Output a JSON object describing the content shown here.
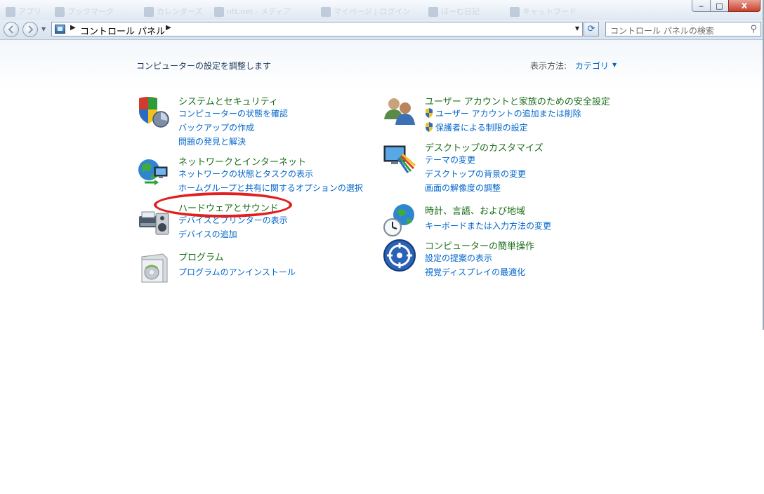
{
  "titlebar": {
    "tabs": [
      "アプリ",
      "ブックマーク",
      "カレンダーズ",
      "ntt.net - メディア",
      "マイページ | ログイン",
      "ほーむ日記 ",
      "キャットフード"
    ]
  },
  "window_controls": {
    "minimize": "‒",
    "maximize": "□",
    "close": "X"
  },
  "nav": {
    "breadcrumb_root": "コントロール パネル",
    "search_placeholder": "コントロール パネルの検索"
  },
  "header": {
    "title": "コンピューターの設定を調整します",
    "view_by_label": "表示方法:",
    "view_by_value": "カテゴリ"
  },
  "categories_left": [
    {
      "icon": "shield-icon",
      "title": "システムとセキュリティ",
      "links": [
        "コンピューターの状態を確認",
        "バックアップの作成",
        "問題の発見と解決"
      ]
    },
    {
      "icon": "network-globe-icon",
      "title": "ネットワークとインターネット",
      "links": [
        "ネットワークの状態とタスクの表示",
        "ホームグループと共有に関するオプションの選択"
      ]
    },
    {
      "icon": "printer-speaker-icon",
      "title": "ハードウェアとサウンド",
      "links": [
        "デバイスとプリンターの表示",
        "デバイスの追加"
      ]
    },
    {
      "icon": "programs-box-icon",
      "title": "プログラム",
      "links": [
        "プログラムのアンインストール"
      ]
    }
  ],
  "categories_right": [
    {
      "icon": "users-icon",
      "title": "ユーザー アカウントと家族のための安全設定",
      "links": [
        "ユーザー アカウントの追加または削除",
        "保護者による制限の設定"
      ]
    },
    {
      "icon": "monitor-palette-icon",
      "title": "デスクトップのカスタマイズ",
      "links": [
        "テーマの変更",
        "デスクトップの背景の変更",
        "画面の解像度の調整"
      ]
    },
    {
      "icon": "clock-globe-icon",
      "title": "時計、言語、および地域",
      "links": [
        "キーボードまたは入力方法の変更"
      ]
    },
    {
      "icon": "ease-of-access-icon",
      "title": "コンピューターの簡単操作",
      "links": [
        "設定の提案の表示",
        "視覚ディスプレイの最適化"
      ]
    }
  ],
  "colors": {
    "category_title": "#1a6e1a",
    "link": "#0066cc",
    "annotation": "#e21e1e"
  }
}
